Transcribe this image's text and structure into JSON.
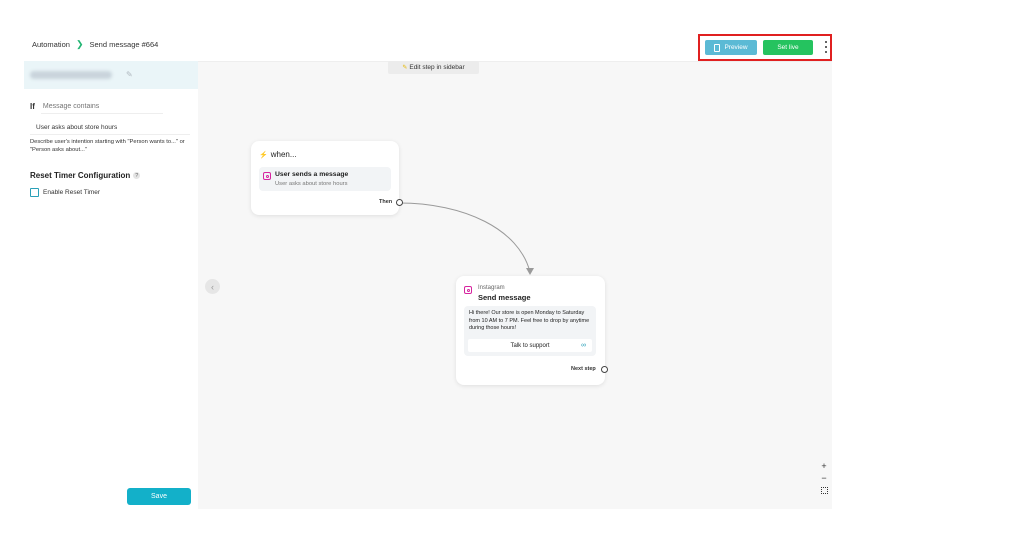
{
  "breadcrumb": {
    "root": "Automation",
    "separator": "❯",
    "current": "Send message #664"
  },
  "toolbar": {
    "preview_label": "Preview",
    "set_live_label": "Set live"
  },
  "sidebar": {
    "if_label": "If",
    "condition_placeholder": "Message contains",
    "intent_value": "User asks about store hours",
    "intent_hint": "Describe user's intention starting with \"Person wants to...\" or \"Person asks about...\"",
    "reset_timer_title": "Reset Timer Configuration",
    "help_glyph": "?",
    "enable_reset_label": "Enable Reset Timer",
    "save_label": "Save"
  },
  "canvas": {
    "hint_label": "Edit step in sidebar",
    "collapse_glyph": "‹",
    "trigger": {
      "header": "when...",
      "item_title": "User sends a message",
      "item_subtitle": "User asks about store hours",
      "then_label": "Then"
    },
    "action": {
      "platform": "Instagram",
      "title": "Send message",
      "message": "Hi there! Our store is open Monday to Saturday from 10 AM to 7 PM. Feel free to drop by anytime during those hours!",
      "button_label": "Talk to support",
      "next_label": "Next step"
    },
    "zoom": {
      "in": "+",
      "out": "−"
    }
  },
  "colors": {
    "preview": "#5bbad5",
    "set_live": "#25c35f",
    "save": "#13b0c9",
    "highlight": "#e02020",
    "instagram": "#d6249f"
  }
}
